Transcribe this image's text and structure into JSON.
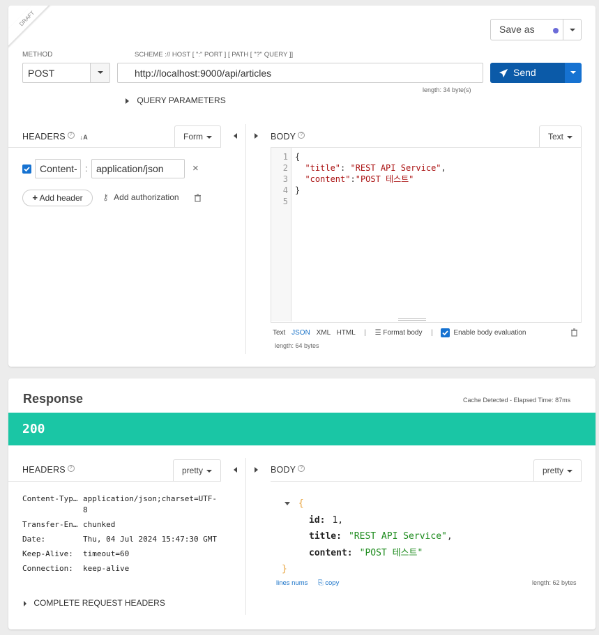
{
  "request": {
    "draft_label": "DRAFT",
    "save_as_label": "Save as",
    "method_label": "METHOD",
    "method_value": "POST",
    "scheme_label": "SCHEME :// HOST [ \":\" PORT ] [ PATH [ \"?\" QUERY ]]",
    "url_value": "http://localhost:9000/api/articles",
    "url_length": "length: 34 byte(s)",
    "send_label": "Send",
    "query_params_label": "QUERY PARAMETERS",
    "headers": {
      "title": "HEADERS",
      "mode": "Form",
      "items": [
        {
          "enabled": true,
          "name": "Content-",
          "value": "application/json"
        }
      ],
      "add_header_label": "Add header",
      "add_auth_label": "Add authorization"
    },
    "body": {
      "title": "BODY",
      "mode": "Text",
      "lines": [
        {
          "num": "1",
          "text": "{"
        },
        {
          "num": "2",
          "key": "\"title\"",
          "sep": ": ",
          "val": "\"REST API Service\"",
          "tail": ","
        },
        {
          "num": "3",
          "key": "\"content\"",
          "sep": ":",
          "val": "\"POST 테스트\"",
          "tail": ""
        },
        {
          "num": "4",
          "text": "}"
        },
        {
          "num": "5",
          "text": ""
        }
      ],
      "format_tabs": [
        "Text",
        "JSON",
        "XML",
        "HTML"
      ],
      "active_format": "JSON",
      "format_body_label": "Format body",
      "enable_eval_label": "Enable body evaluation",
      "length": "length: 64 bytes"
    }
  },
  "response": {
    "title": "Response",
    "cache_info": "Cache Detected - Elapsed Time: 87ms",
    "status_code": "200",
    "status_color": "#1ac6a5",
    "headers": {
      "title": "HEADERS",
      "mode": "pretty",
      "items": [
        {
          "name": "Content-Typ…",
          "value": "application/json;charset=UTF-",
          "value2": "8"
        },
        {
          "name": "Transfer-En…",
          "value": "chunked"
        },
        {
          "name": "Date:",
          "value": "Thu, 04 Jul 2024 15:47:30 GMT"
        },
        {
          "name": "Keep-Alive:",
          "value": "timeout=60"
        },
        {
          "name": "Connection:",
          "value": "keep-alive"
        }
      ],
      "complete_label": "COMPLETE REQUEST HEADERS"
    },
    "body": {
      "title": "BODY",
      "mode": "pretty",
      "open_brace": "{",
      "close_brace": "}",
      "fields": [
        {
          "key": "id:",
          "value": "1,",
          "type": "number"
        },
        {
          "key": "title:",
          "value": "\"REST API Service\"",
          "comma": ",",
          "type": "string"
        },
        {
          "key": "content:",
          "value": "\"POST 테스트\"",
          "comma": "",
          "type": "string"
        }
      ],
      "lines_nums_label": "lines nums",
      "copy_label": "copy",
      "length": "length: 62 bytes"
    }
  },
  "colors": {
    "primary": "#0b5aa8",
    "accent": "#1ac6a5",
    "dot": "#6b6bd8"
  }
}
